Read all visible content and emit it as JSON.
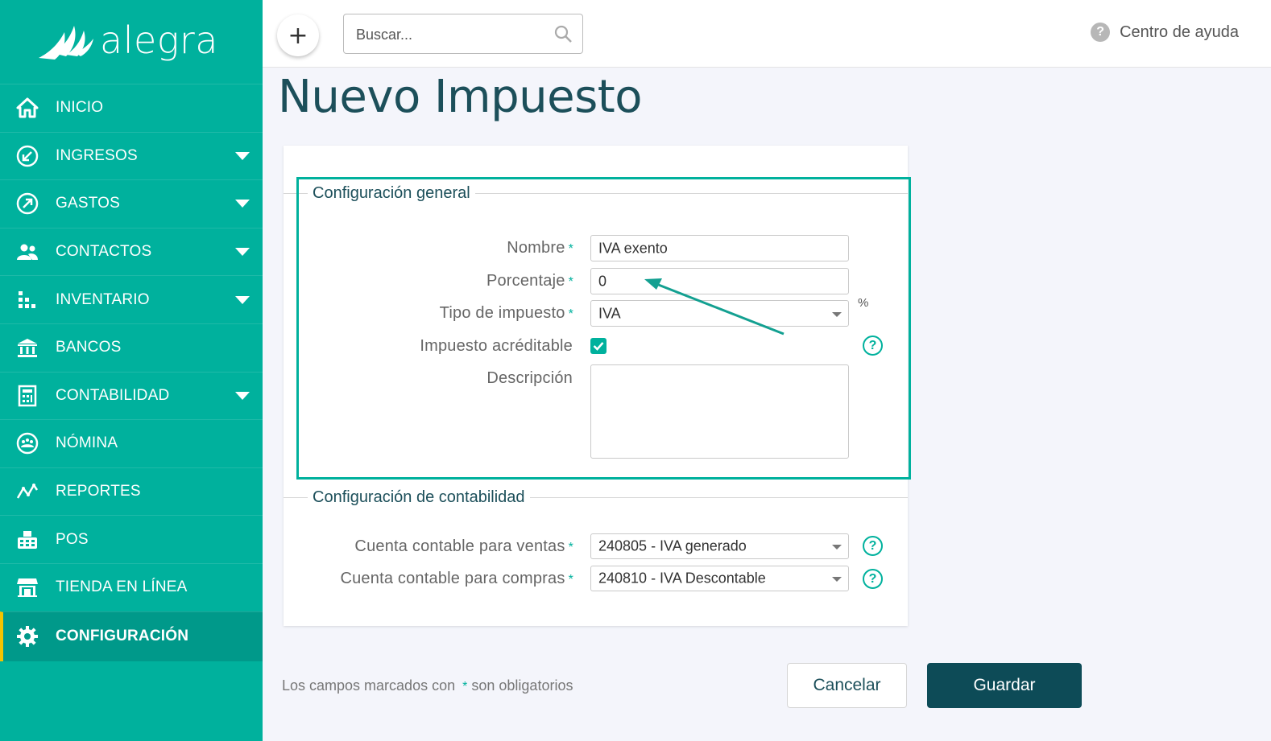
{
  "app": {
    "brand": "alegra",
    "accent": "#00b19d",
    "dark_accent": "#0d4b57"
  },
  "sidebar": {
    "items": [
      {
        "label": "INICIO",
        "icon": "home-icon",
        "has_submenu": false,
        "active": false
      },
      {
        "label": "INGRESOS",
        "icon": "incoming-arrow-icon",
        "has_submenu": true,
        "active": false
      },
      {
        "label": "GASTOS",
        "icon": "outgoing-arrow-icon",
        "has_submenu": true,
        "active": false
      },
      {
        "label": "CONTACTOS",
        "icon": "users-icon",
        "has_submenu": true,
        "active": false
      },
      {
        "label": "INVENTARIO",
        "icon": "inventory-icon",
        "has_submenu": true,
        "active": false
      },
      {
        "label": "BANCOS",
        "icon": "bank-icon",
        "has_submenu": false,
        "active": false
      },
      {
        "label": "CONTABILIDAD",
        "icon": "calculator-icon",
        "has_submenu": true,
        "active": false
      },
      {
        "label": "NÓMINA",
        "icon": "payroll-icon",
        "has_submenu": false,
        "active": false
      },
      {
        "label": "REPORTES",
        "icon": "reports-icon",
        "has_submenu": false,
        "active": false
      },
      {
        "label": "POS",
        "icon": "pos-icon",
        "has_submenu": false,
        "active": false
      },
      {
        "label": "TIENDA EN LÍNEA",
        "icon": "store-icon",
        "has_submenu": false,
        "active": false
      },
      {
        "label": "CONFIGURACIÓN",
        "icon": "gear-icon",
        "has_submenu": false,
        "active": true
      }
    ]
  },
  "topbar": {
    "add_label": "+",
    "search_placeholder": "Buscar...",
    "help_label": "Centro de ayuda"
  },
  "page": {
    "title": "Nuevo Impuesto"
  },
  "general": {
    "section_title": "Configuración general",
    "nombre_label": "Nombre",
    "nombre_value": "IVA exento",
    "porcentaje_label": "Porcentaje",
    "porcentaje_value": "0",
    "percent_symbol": "%",
    "tipo_label": "Tipo de impuesto",
    "tipo_value": "IVA",
    "acreditable_label": "Impuesto acréditable",
    "acreditable_checked": true,
    "descripcion_label": "Descripción",
    "descripcion_value": ""
  },
  "accounting": {
    "section_title": "Configuración de contabilidad",
    "ventas_label": "Cuenta contable para ventas",
    "ventas_value": "240805 - IVA generado",
    "compras_label": "Cuenta contable para compras",
    "compras_value": "240810 - IVA Descontable"
  },
  "required_mark": "*",
  "footer": {
    "note_before": "Los campos marcados con",
    "note_after": "son obligatorios",
    "cancel_label": "Cancelar",
    "save_label": "Guardar"
  }
}
